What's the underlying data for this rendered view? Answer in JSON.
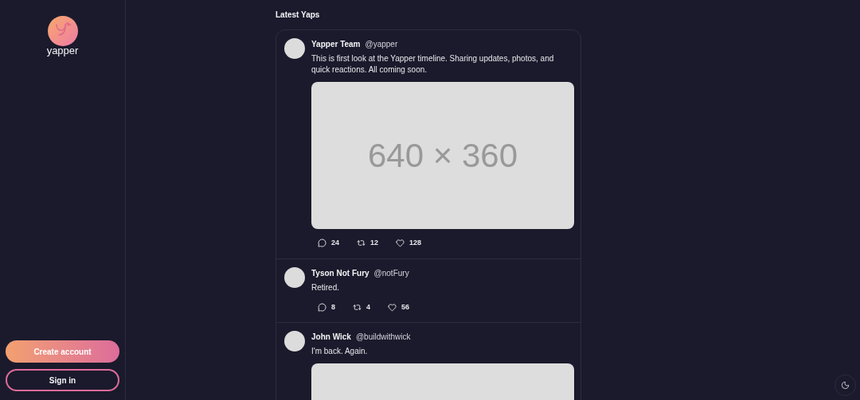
{
  "brand": {
    "name": "yapper"
  },
  "sidebar": {
    "buttons": [
      {
        "label": "Create account",
        "kind": "primary"
      },
      {
        "label": "Sign in",
        "kind": "outline"
      }
    ]
  },
  "feed": {
    "title": "Latest Yaps",
    "posts": [
      {
        "name": "Yapper Team",
        "handle": "@yapper",
        "text": "This is first look at the Yapper timeline. Sharing updates, photos, and quick reactions. All coming soon.",
        "image": {
          "kind": "placeholder",
          "label": "640 × 360"
        },
        "replies": "24",
        "reposts": "12",
        "likes": "128"
      },
      {
        "name": "Tyson Not Fury",
        "handle": "@notFury",
        "text": "Retired.",
        "replies": "8",
        "reposts": "4",
        "likes": "56"
      },
      {
        "name": "John Wick",
        "handle": "@buildwithwick",
        "text": "I'm back. Again.",
        "image": {
          "kind": "placeholder"
        }
      }
    ]
  }
}
